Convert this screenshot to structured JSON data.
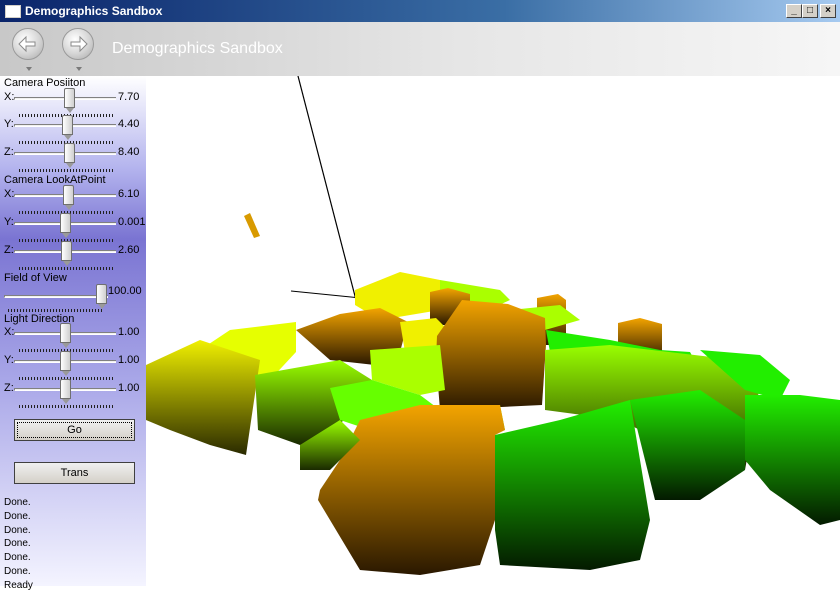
{
  "window": {
    "title": "Demographics Sandbox",
    "controls": [
      "_",
      "□",
      "×"
    ]
  },
  "toolbar": {
    "back_icon": "back-arrow-icon",
    "forward_icon": "forward-arrow-icon",
    "title": "Demographics Sandbox"
  },
  "sidebar": {
    "camera_position": {
      "heading": "Camera Posiiton",
      "x": {
        "label": "X:",
        "value": "7.70"
      },
      "y": {
        "label": "Y:",
        "value": "4.40"
      },
      "z": {
        "label": "Z:",
        "value": "8.40"
      }
    },
    "camera_lookat": {
      "heading": "Camera LookAtPoint",
      "x": {
        "label": "X:",
        "value": "6.10"
      },
      "y": {
        "label": "Y:",
        "value": "0.001"
      },
      "z": {
        "label": "Z:",
        "value": "2.60"
      }
    },
    "fov": {
      "heading": "Field of View",
      "value": "100.00"
    },
    "light": {
      "heading": "Light Direction",
      "x": {
        "label": "X:",
        "value": "1.00"
      },
      "y": {
        "label": "Y:",
        "value": "1.00"
      },
      "z": {
        "label": "Z:",
        "value": "1.00"
      }
    },
    "go_label": "Go",
    "trans_label": "Trans",
    "log": [
      "Done.",
      "Done.",
      "Done.",
      "Done.",
      "Done.",
      "Done.",
      "Ready"
    ]
  },
  "colors": {
    "orange": "#f6a800",
    "green": "#22ee00",
    "yellow_green": "#aaff00",
    "yellow": "#f0f000"
  }
}
